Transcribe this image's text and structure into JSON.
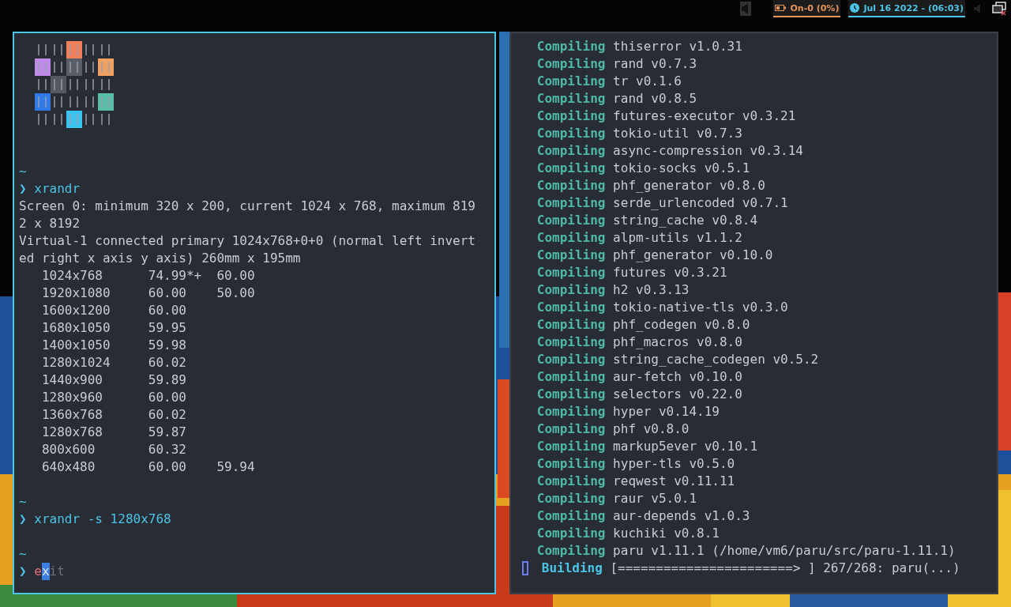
{
  "top_bar": {
    "battery": "On-0 (0%)",
    "clock": "Jul 16 2022 - (06:03)"
  },
  "terminals": [
    {
      "focused": true,
      "lines": [
        {
          "kind": "logo"
        },
        {
          "kind": "blank"
        },
        {
          "kind": "tilde",
          "text": "~"
        },
        {
          "kind": "prompt",
          "symbol": "❯",
          "command": "xrandr"
        },
        {
          "kind": "output",
          "text": "Screen 0: minimum 320 x 200, current 1024 x 768, maximum 819"
        },
        {
          "kind": "output",
          "text": "2 x 8192"
        },
        {
          "kind": "output",
          "text": "Virtual-1 connected primary 1024x768+0+0 (normal left invert"
        },
        {
          "kind": "output",
          "text": "ed right x axis y axis) 260mm x 195mm"
        },
        {
          "kind": "output",
          "text": "   1024x768      74.99*+  60.00"
        },
        {
          "kind": "output",
          "text": "   1920x1080     60.00    50.00"
        },
        {
          "kind": "output",
          "text": "   1600x1200     60.00"
        },
        {
          "kind": "output",
          "text": "   1680x1050     59.95"
        },
        {
          "kind": "output",
          "text": "   1400x1050     59.98"
        },
        {
          "kind": "output",
          "text": "   1280x1024     60.02"
        },
        {
          "kind": "output",
          "text": "   1440x900      59.89"
        },
        {
          "kind": "output",
          "text": "   1280x960      60.00"
        },
        {
          "kind": "output",
          "text": "   1360x768      60.02"
        },
        {
          "kind": "output",
          "text": "   1280x768      59.87"
        },
        {
          "kind": "output",
          "text": "   800x600       60.32"
        },
        {
          "kind": "output",
          "text": "   640x480       60.00    59.94"
        },
        {
          "kind": "blank"
        },
        {
          "kind": "tilde",
          "text": "~"
        },
        {
          "kind": "prompt",
          "symbol": "❯",
          "command": "xrandr -s 1280x768"
        },
        {
          "kind": "blank"
        },
        {
          "kind": "tilde",
          "text": "~"
        },
        {
          "kind": "editing",
          "symbol": "❯",
          "typed": "e",
          "cursor": "x",
          "suggestion": "it"
        }
      ]
    },
    {
      "focused": false,
      "lines": [
        {
          "kind": "cargo",
          "status": "Compiling",
          "text": "thiserror v1.0.31"
        },
        {
          "kind": "cargo",
          "status": "Compiling",
          "text": "rand v0.7.3"
        },
        {
          "kind": "cargo",
          "status": "Compiling",
          "text": "tr v0.1.6"
        },
        {
          "kind": "cargo",
          "status": "Compiling",
          "text": "rand v0.8.5"
        },
        {
          "kind": "cargo",
          "status": "Compiling",
          "text": "futures-executor v0.3.21"
        },
        {
          "kind": "cargo",
          "status": "Compiling",
          "text": "tokio-util v0.7.3"
        },
        {
          "kind": "cargo",
          "status": "Compiling",
          "text": "async-compression v0.3.14"
        },
        {
          "kind": "cargo",
          "status": "Compiling",
          "text": "tokio-socks v0.5.1"
        },
        {
          "kind": "cargo",
          "status": "Compiling",
          "text": "phf_generator v0.8.0"
        },
        {
          "kind": "cargo",
          "status": "Compiling",
          "text": "serde_urlencoded v0.7.1"
        },
        {
          "kind": "cargo",
          "status": "Compiling",
          "text": "string_cache v0.8.4"
        },
        {
          "kind": "cargo",
          "status": "Compiling",
          "text": "alpm-utils v1.1.2"
        },
        {
          "kind": "cargo",
          "status": "Compiling",
          "text": "phf_generator v0.10.0"
        },
        {
          "kind": "cargo",
          "status": "Compiling",
          "text": "futures v0.3.21"
        },
        {
          "kind": "cargo",
          "status": "Compiling",
          "text": "h2 v0.3.13"
        },
        {
          "kind": "cargo",
          "status": "Compiling",
          "text": "tokio-native-tls v0.3.0"
        },
        {
          "kind": "cargo",
          "status": "Compiling",
          "text": "phf_codegen v0.8.0"
        },
        {
          "kind": "cargo",
          "status": "Compiling",
          "text": "phf_macros v0.8.0"
        },
        {
          "kind": "cargo",
          "status": "Compiling",
          "text": "string_cache_codegen v0.5.2"
        },
        {
          "kind": "cargo",
          "status": "Compiling",
          "text": "aur-fetch v0.10.0"
        },
        {
          "kind": "cargo",
          "status": "Compiling",
          "text": "selectors v0.22.0"
        },
        {
          "kind": "cargo",
          "status": "Compiling",
          "text": "hyper v0.14.19"
        },
        {
          "kind": "cargo",
          "status": "Compiling",
          "text": "phf v0.8.0"
        },
        {
          "kind": "cargo",
          "status": "Compiling",
          "text": "markup5ever v0.10.1"
        },
        {
          "kind": "cargo",
          "status": "Compiling",
          "text": "hyper-tls v0.5.0"
        },
        {
          "kind": "cargo",
          "status": "Compiling",
          "text": "reqwest v0.11.11"
        },
        {
          "kind": "cargo",
          "status": "Compiling",
          "text": "raur v5.0.1"
        },
        {
          "kind": "cargo",
          "status": "Compiling",
          "text": "aur-depends v1.0.3"
        },
        {
          "kind": "cargo",
          "status": "Compiling",
          "text": "kuchiki v0.8.1"
        },
        {
          "kind": "cargo",
          "status": "Compiling",
          "text": "paru v1.11.1 (/home/vm6/paru/src/paru-1.11.1)"
        },
        {
          "kind": "progress",
          "status": "Building",
          "text": "[=======================> ] 267/268: paru(...)"
        }
      ]
    }
  ]
}
